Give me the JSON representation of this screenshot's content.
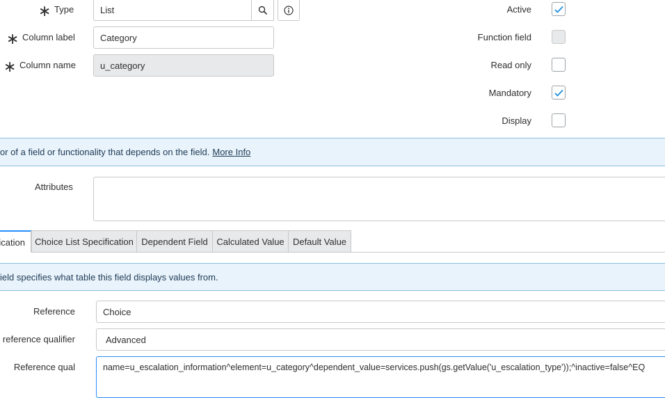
{
  "form": {
    "type": {
      "label": "Type",
      "value": "List"
    },
    "column_label": {
      "label": "Column label",
      "value": "Category"
    },
    "column_name": {
      "label": "Column name",
      "value": "u_category"
    },
    "active": {
      "label": "Active",
      "checked": true
    },
    "function_field": {
      "label": "Function field",
      "checked": false,
      "disabled": true
    },
    "read_only": {
      "label": "Read only",
      "checked": false
    },
    "mandatory": {
      "label": "Mandatory",
      "checked": true
    },
    "display": {
      "label": "Display",
      "checked": false
    },
    "info_message": "or of a field or functionality that depends on the field.",
    "info_link": "More Info",
    "attributes": {
      "label": "Attributes",
      "value": ""
    }
  },
  "tabs": [
    {
      "label": "ication",
      "active": true
    },
    {
      "label": "Choice List Specification",
      "active": false
    },
    {
      "label": "Dependent Field",
      "active": false
    },
    {
      "label": "Calculated Value",
      "active": false
    },
    {
      "label": "Default Value",
      "active": false
    }
  ],
  "reference_section": {
    "info_message": "ield specifies what table this field displays values from.",
    "reference": {
      "label": "Reference",
      "value": "Choice"
    },
    "qualifier_type": {
      "label": "e reference qualifier",
      "value": "Advanced"
    },
    "reference_qual": {
      "label": "Reference qual",
      "value": "name=u_escalation_information^element=u_category^dependent_value=services.push(gs.getValue('u_escalation_type'));^inactive=false^EQ"
    }
  },
  "colors": {
    "accent": "#278efc",
    "check": "#1f8dd6",
    "info_bg": "#e9f3fb",
    "info_border": "#8bbedf"
  }
}
